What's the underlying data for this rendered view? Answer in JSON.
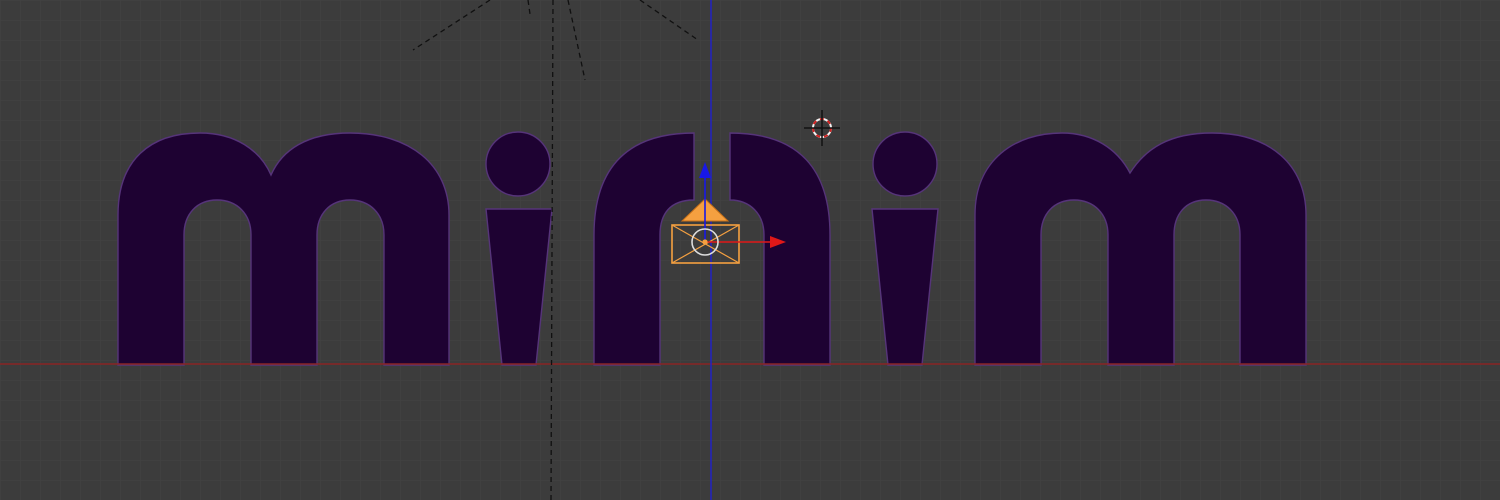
{
  "editor": "3d-viewport",
  "view": "front-orthographic",
  "text_object": {
    "body": "minim"
  },
  "colors": {
    "background": "#3c3c3c",
    "grid_line": "#434343",
    "x_axis": "#8a2424",
    "z_axis": "#2020ce",
    "text_fill": "#1e0232",
    "text_edge": "#56347a",
    "selection": "#f5a040",
    "gizmo_x": "#e01818",
    "gizmo_z": "#1818e6"
  },
  "icons": {
    "cursor": "3d-cursor-icon",
    "camera": "camera-icon",
    "gizmo": "transform-gizmo-icon"
  },
  "overlays": {
    "grid": true,
    "axes": [
      "x",
      "z"
    ],
    "camera_selected": true
  }
}
